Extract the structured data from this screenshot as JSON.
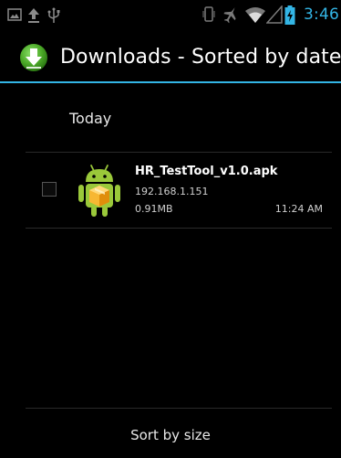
{
  "status_bar": {
    "time": "3:46",
    "icons": [
      "picture-icon",
      "upload-icon",
      "usb-icon",
      "vibrate-icon",
      "airplane-icon",
      "wifi-icon",
      "signal-icon",
      "battery-icon"
    ]
  },
  "action_bar": {
    "title": "Downloads - Sorted by date",
    "icon": "download-icon"
  },
  "content": {
    "section_header": "Today",
    "items": [
      {
        "name": "HR_TestTool_v1.0.apk",
        "source": "192.168.1.151",
        "size": "0.91MB",
        "time": "11:24 AM",
        "checked": false,
        "icon": "android-app-icon"
      }
    ]
  },
  "footer": {
    "sort_label": "Sort by size"
  },
  "colors": {
    "accent": "#33b5e5",
    "background": "#000000",
    "download_green": "#5bb52b",
    "android_green": "#9ac83a",
    "package_orange": "#f5a623"
  }
}
